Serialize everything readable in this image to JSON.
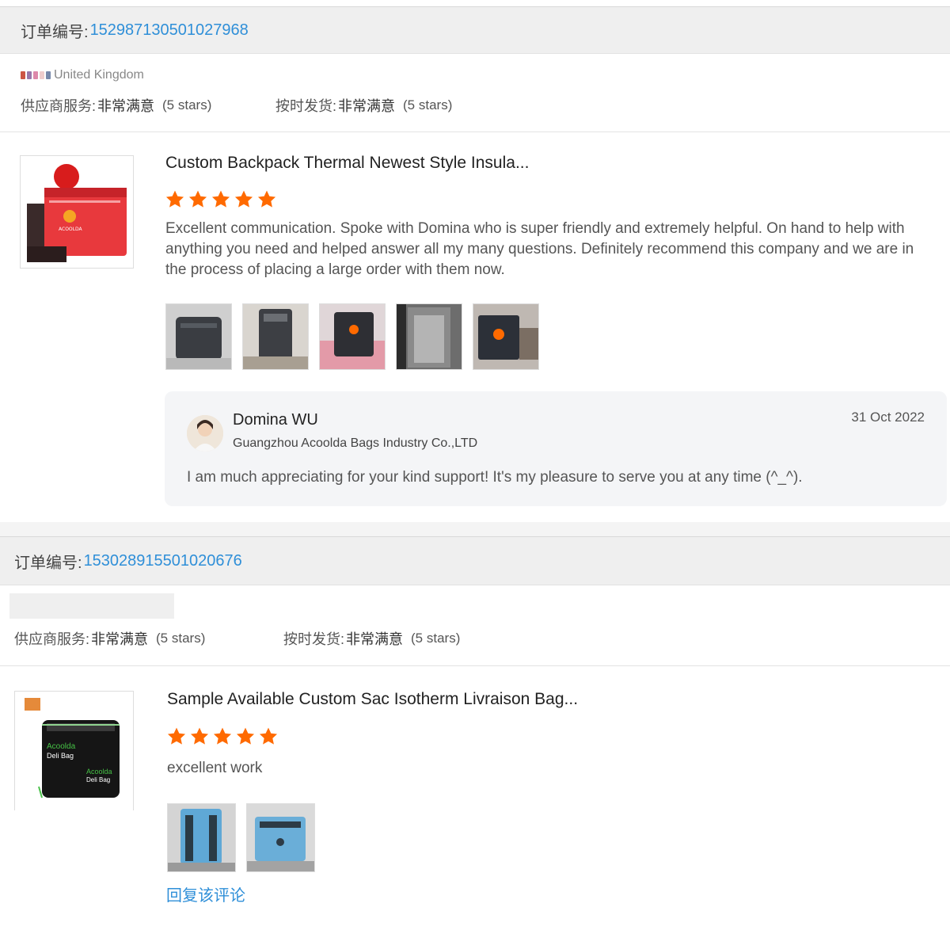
{
  "orders": [
    {
      "order_label": "订单编号:",
      "order_number": "152987130501027968",
      "buyer_country": "United Kingdom",
      "supplier_service_label": "供应商服务:",
      "supplier_service_value": "非常满意",
      "supplier_service_stars": "(5 stars)",
      "on_time_label": "按时发货:",
      "on_time_value": "非常满意",
      "on_time_stars": "(5 stars)",
      "product_title": "Custom Backpack Thermal Newest Style Insula...",
      "rating": 5,
      "review_text": "Excellent communication. Spoke with Domina who is super friendly and extremely helpful. On hand to help with anything you need and helped answer all my many questions. Definitely recommend this company and we are in the process of placing a large order with them now.",
      "review_images": [
        "photo-1",
        "photo-2",
        "photo-3",
        "photo-4",
        "photo-5"
      ],
      "reply": {
        "name": "Domina WU",
        "company": "Guangzhou Acoolda Bags Industry Co.,LTD",
        "date": "31 Oct 2022",
        "text": "I am much appreciating for your kind support! It's my pleasure to serve you at any time (^_^)."
      }
    },
    {
      "order_label": "订单编号:",
      "order_number": "153028915501020676",
      "supplier_service_label": "供应商服务:",
      "supplier_service_value": "非常满意",
      "supplier_service_stars": "(5 stars)",
      "on_time_label": "按时发货:",
      "on_time_value": "非常满意",
      "on_time_stars": "(5 stars)",
      "product_title": "Sample Available Custom Sac Isotherm Livraison Bag...",
      "product_logo_text": [
        "Acoolda",
        "Deli Bag"
      ],
      "rating": 5,
      "review_text": "excellent work",
      "review_images": [
        "photo-1",
        "photo-2"
      ],
      "reply_link": "回复该评论"
    }
  ],
  "colors": {
    "link_blue": "#2f8fd8",
    "star_orange": "#ff6a00",
    "header_bg": "#efefef"
  }
}
